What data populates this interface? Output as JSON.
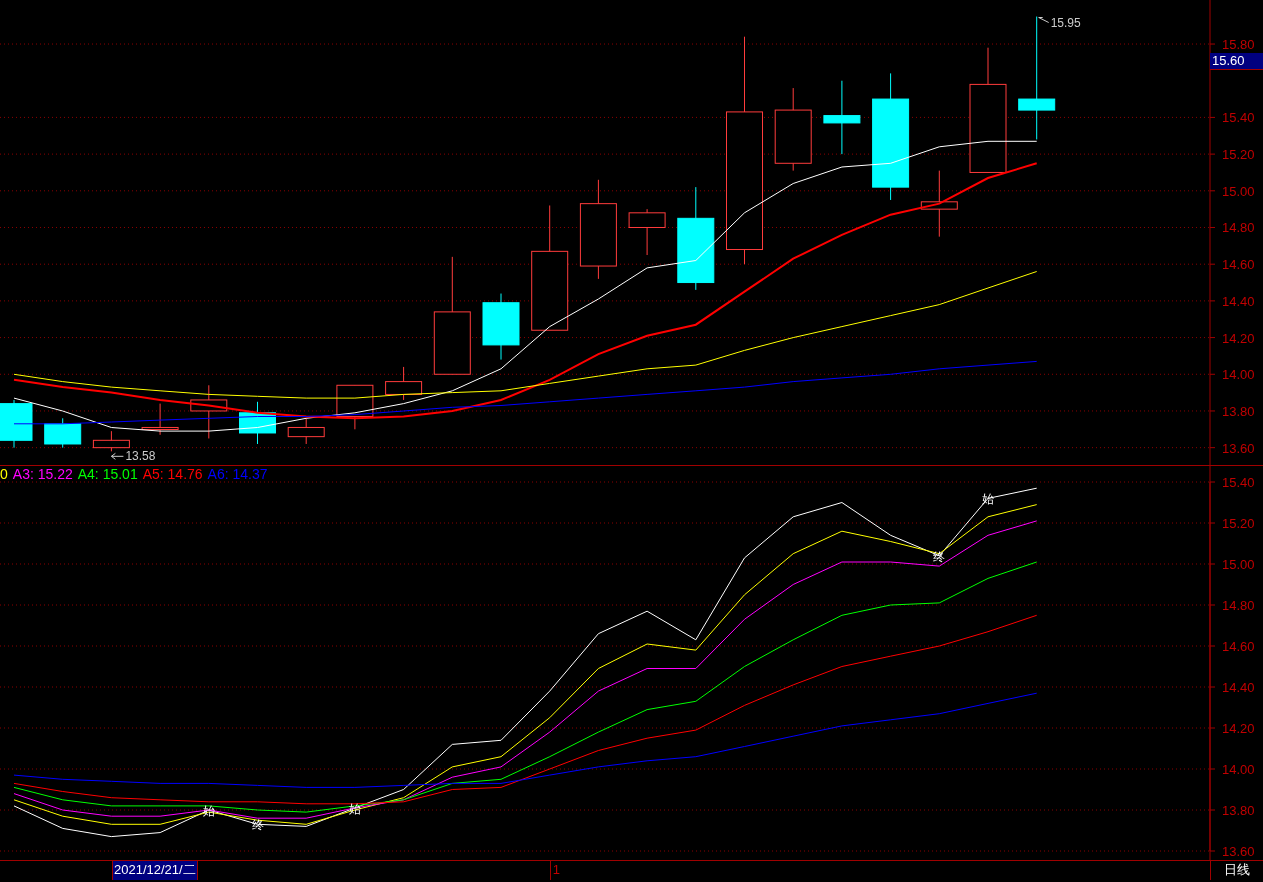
{
  "price_chart": {
    "price_label": "15.60",
    "chart_data": {
      "type": "line",
      "yticks": [
        {
          "value": 13.6,
          "label": "13.60"
        },
        {
          "value": 13.8,
          "label": "13.80"
        },
        {
          "value": 14.0,
          "label": "14.00"
        },
        {
          "value": 14.2,
          "label": "14.20"
        },
        {
          "value": 14.4,
          "label": "14.40"
        },
        {
          "value": 14.6,
          "label": "14.60"
        },
        {
          "value": 14.8,
          "label": "14.80"
        },
        {
          "value": 15.0,
          "label": "15.00"
        },
        {
          "value": 15.2,
          "label": "15.20"
        },
        {
          "value": 15.4,
          "label": "15.40"
        },
        {
          "value": 15.8,
          "label": "15.80"
        }
      ],
      "ylim": [
        13.5,
        16.04
      ],
      "grid": true,
      "series": [
        {
          "color": "#ffffff",
          "values": [
            13.87,
            13.8,
            13.71,
            13.69,
            13.69,
            13.71,
            13.76,
            13.79,
            13.84,
            13.91,
            14.03,
            14.26,
            14.41,
            14.58,
            14.62,
            14.88,
            15.04,
            15.13,
            15.15,
            15.24,
            15.27,
            15.27
          ]
        },
        {
          "color": "#ff0000",
          "values": [
            13.97,
            13.93,
            13.9,
            13.86,
            13.83,
            13.79,
            13.77,
            13.76,
            13.77,
            13.8,
            13.86,
            13.97,
            14.11,
            14.21,
            14.27,
            14.45,
            14.63,
            14.76,
            14.87,
            14.93,
            15.07,
            15.15
          ]
        },
        {
          "color": "#ffff00",
          "values": [
            14.0,
            13.96,
            13.93,
            13.91,
            13.89,
            13.88,
            13.87,
            13.87,
            13.89,
            13.9,
            13.91,
            13.95,
            13.99,
            14.03,
            14.05,
            14.13,
            14.2,
            14.26,
            14.32,
            14.38,
            14.47,
            14.56
          ]
        },
        {
          "color": "#0000ff",
          "values": [
            13.73,
            13.73,
            13.74,
            13.75,
            13.76,
            13.77,
            13.77,
            13.78,
            13.8,
            13.82,
            13.83,
            13.85,
            13.87,
            13.89,
            13.91,
            13.93,
            13.96,
            13.98,
            14.0,
            14.03,
            14.05,
            14.07
          ]
        }
      ]
    },
    "high_label": "15.95",
    "low_label": "13.58"
  },
  "indicator_chart": {
    "legend": [
      {
        "text": "0",
        "color": "#ffff00"
      },
      {
        "text": "A3: 15.22",
        "color": "#ff00ff"
      },
      {
        "text": "A4: 15.01",
        "color": "#00ff00"
      },
      {
        "text": "A5: 14.76",
        "color": "#ff0000"
      },
      {
        "text": "A6: 14.37",
        "color": "#0000ff"
      }
    ],
    "chart_data": {
      "type": "line",
      "ylim": [
        13.6,
        15.4
      ],
      "grid": true,
      "yticks": [
        {
          "value": 13.6,
          "label": "13.60"
        },
        {
          "value": 13.8,
          "label": "13.80"
        },
        {
          "value": 14.0,
          "label": "14.00"
        },
        {
          "value": 14.2,
          "label": "14.20"
        },
        {
          "value": 14.4,
          "label": "14.40"
        },
        {
          "value": 14.6,
          "label": "14.60"
        },
        {
          "value": 14.8,
          "label": "14.80"
        },
        {
          "value": 15.0,
          "label": "15.00"
        },
        {
          "value": 15.2,
          "label": "15.20"
        },
        {
          "value": 15.4,
          "label": "15.40"
        }
      ],
      "series": [
        {
          "color": "#ffffff",
          "values": [
            13.82,
            13.71,
            13.67,
            13.69,
            13.8,
            13.73,
            13.72,
            13.81,
            13.9,
            14.12,
            14.14,
            14.38,
            14.66,
            14.77,
            14.63,
            15.03,
            15.23,
            15.3,
            15.14,
            15.04,
            15.32,
            15.37
          ]
        },
        {
          "color": "#ffff00",
          "values": [
            13.85,
            13.77,
            13.73,
            13.73,
            13.79,
            13.75,
            13.73,
            13.8,
            13.86,
            14.01,
            14.06,
            14.25,
            14.49,
            14.61,
            14.58,
            14.85,
            15.05,
            15.16,
            15.11,
            15.05,
            15.23,
            15.29
          ]
        },
        {
          "color": "#ff00ff",
          "values": [
            13.88,
            13.8,
            13.77,
            13.77,
            13.8,
            13.76,
            13.76,
            13.81,
            13.85,
            13.96,
            14.01,
            14.18,
            14.38,
            14.49,
            14.49,
            14.73,
            14.9,
            15.01,
            15.01,
            14.99,
            15.14,
            15.21
          ]
        },
        {
          "color": "#00ff00",
          "values": [
            13.91,
            13.85,
            13.82,
            13.82,
            13.82,
            13.8,
            13.79,
            13.82,
            13.85,
            13.93,
            13.95,
            14.06,
            14.18,
            14.29,
            14.33,
            14.5,
            14.63,
            14.75,
            14.8,
            14.81,
            14.93,
            15.01
          ]
        },
        {
          "color": "#ff0000",
          "values": [
            13.93,
            13.89,
            13.86,
            13.85,
            13.84,
            13.84,
            13.83,
            13.83,
            13.84,
            13.9,
            13.91,
            14.0,
            14.09,
            14.15,
            14.19,
            14.31,
            14.41,
            14.5,
            14.55,
            14.6,
            14.67,
            14.75
          ]
        },
        {
          "color": "#0000ff",
          "values": [
            13.97,
            13.95,
            13.94,
            13.93,
            13.93,
            13.92,
            13.91,
            13.91,
            13.92,
            13.93,
            13.93,
            13.97,
            14.01,
            14.04,
            14.06,
            14.11,
            14.16,
            14.21,
            14.24,
            14.27,
            14.32,
            14.37
          ]
        }
      ],
      "annotations": [
        {
          "text": "始",
          "y": 13.8
        },
        {
          "text": "终",
          "y": 13.73
        },
        {
          "text": "始",
          "y": 13.81
        },
        {
          "text": "终",
          "y": 15.04
        },
        {
          "text": "始",
          "y": 15.32
        }
      ]
    }
  },
  "status_bar": {
    "date": "2021/12/21/二",
    "marker": "1",
    "period": "日线"
  }
}
